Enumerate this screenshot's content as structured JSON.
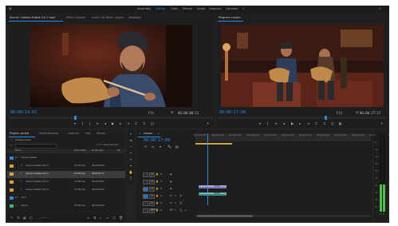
{
  "top_bar": {
    "workspaces": [
      {
        "label": "Assembly",
        "active": false
      },
      {
        "label": "Editing",
        "active": true
      },
      {
        "label": "Color",
        "active": false
      },
      {
        "label": "Effects",
        "active": false
      },
      {
        "label": "Audio",
        "active": false
      },
      {
        "label": "Graphics",
        "active": false
      },
      {
        "label": "Libraries",
        "active": false
      }
    ]
  },
  "source_panel": {
    "tabs": [
      "Source: Camera Rubble Cut 1.mp4",
      "Effect Controls",
      "Audio Clip Mixer: Lesson",
      "Metadata"
    ],
    "timecode_in": "00:00:14:02",
    "fit_label": "Fit",
    "timecode_out": "00:00:08:11",
    "video_description": "close-up of bearded guitarist in beanie playing acoustic guitar"
  },
  "program_panel": {
    "tab": "Program: Lesson",
    "timecode_in": "00:00:17:09",
    "fit_label": "Fit",
    "timecode_out": "00:00:27:17",
    "video_description": "two guitarists playing acoustic guitars in room with rugs and lamps"
  },
  "project_panel": {
    "tabs": [
      "Project: panels",
      "Media Browser",
      "Libraries",
      "Info",
      "Effects"
    ],
    "project_name": "panels.prproj",
    "item_count": "1 of 7 items selected",
    "columns": [
      "Name",
      "Frame Rate",
      "Media Start",
      "Me"
    ],
    "rows": [
      {
        "name": "Camera Rubble",
        "rate": "",
        "start": "",
        "color": "#3f7fd6"
      },
      {
        "name": "Camera Rubble Cam 1",
        "rate": "23.976 fps",
        "start": "00:00:00:00",
        "color": "#d6a03f"
      },
      {
        "name": "Camera Rubble Cam 1",
        "rate": "23.976 fps",
        "start": "00:00:27:17",
        "color": "#d6a03f"
      },
      {
        "name": "Camera Rubble Cam 3",
        "rate": "23.976 fps",
        "start": "00:00:00:00",
        "color": "#d6a03f"
      },
      {
        "name": "Camera Rubble Cam 4",
        "rate": "23.976 fps",
        "start": "00:00:00:00",
        "color": "#d6a03f"
      },
      {
        "name": "Color",
        "rate": "",
        "start": "",
        "color": "#3f7fd6"
      },
      {
        "name": "Lesson",
        "rate": "23.976 fps",
        "start": "00:00:00:00",
        "color": "#3fb86f"
      }
    ]
  },
  "timeline_panel": {
    "tab": "Lesson",
    "timecode": "00:00:17:09",
    "ticks": [
      "00:00:14:23",
      "00:00:00:00",
      "00:00:04:23",
      "00:00:09:23",
      "00:00:14:23",
      "00:00:19:23",
      "00:00:24:23",
      "00:00:29:23",
      "00:00:34:23",
      "00:00:39:23",
      "00:00:44:23",
      "00:00:49:23"
    ],
    "video_tracks": [
      "V3",
      "V2",
      "V1"
    ],
    "audio_tracks": [
      "A1",
      "A2",
      "A3"
    ],
    "master_label": "Master",
    "master_value": "0.0",
    "clips": [
      {
        "label": "Camera Rubble",
        "kind": "video"
      },
      {
        "label": "Camera Rubble",
        "kind": "video"
      },
      {
        "label": "Camera Rubble",
        "kind": "audio"
      },
      {
        "label": "Camera Rubble",
        "kind": "audio"
      }
    ]
  },
  "meter": {
    "levels": [
      0.35,
      0.35
    ],
    "labels": [
      "0",
      "-6",
      "-12",
      "-18",
      "-24",
      "-30",
      "-36",
      "-42",
      "-48",
      "-54",
      "dB"
    ]
  },
  "colors": {
    "accent": "#2d8ceb",
    "background": "#232323",
    "panel": "#1e1e1e"
  }
}
